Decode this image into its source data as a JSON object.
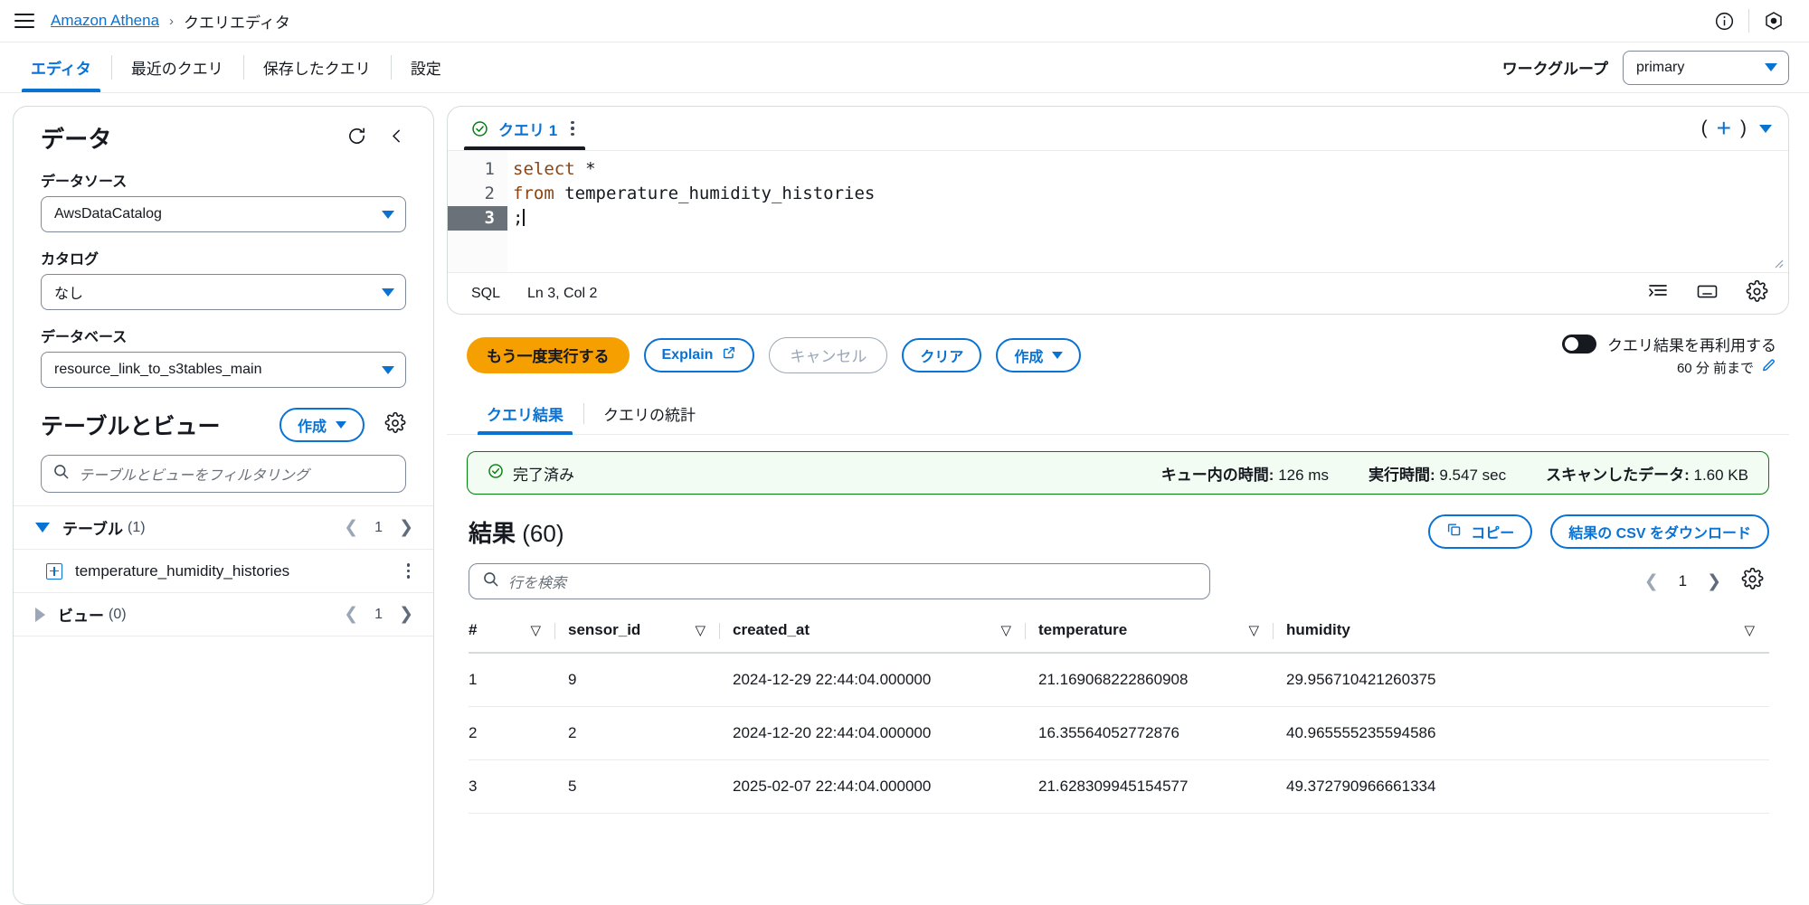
{
  "header": {
    "menu_icon": "hamburger-icon",
    "breadcrumb_root": "Amazon Athena",
    "breadcrumb_sep": "›",
    "breadcrumb_current": "クエリエディタ",
    "info_icon": "info-icon",
    "settings_icon": "aws-console-icon"
  },
  "nav": {
    "tabs": [
      {
        "label": "エディタ",
        "active": true
      },
      {
        "label": "最近のクエリ",
        "active": false
      },
      {
        "label": "保存したクエリ",
        "active": false
      },
      {
        "label": "設定",
        "active": false
      }
    ],
    "workgroup_label": "ワークグループ",
    "workgroup_value": "primary"
  },
  "sidebar": {
    "title": "データ",
    "refresh_icon": "refresh-icon",
    "collapse_icon": "chevron-left-icon",
    "datasource_label": "データソース",
    "datasource_value": "AwsDataCatalog",
    "catalog_label": "カタログ",
    "catalog_value": "なし",
    "database_label": "データベース",
    "database_value": "resource_link_to_s3tables_main",
    "tables_views_title": "テーブルとビュー",
    "create_label": "作成",
    "gear_icon": "gear-icon",
    "filter_placeholder": "テーブルとビューをフィルタリング",
    "tables_group": "テーブル",
    "tables_count": "(1)",
    "tables_page": "1",
    "views_group": "ビュー",
    "views_count": "(0)",
    "views_page": "1",
    "table_items": [
      {
        "name": "temperature_humidity_histories"
      }
    ]
  },
  "editor": {
    "tab_name": "クエリ 1",
    "tab_status_icon": "check-circle-icon",
    "tab_menu_icon": "kebab-menu-icon",
    "add_tab_icon": "plus-icon",
    "tab_list_caret": "chevron-down-icon",
    "paren_left": "(",
    "paren_right": ")",
    "lines": [
      {
        "no": "1",
        "keyword": "select",
        "rest": " *",
        "current": false
      },
      {
        "no": "2",
        "keyword": "from",
        "rest": " temperature_humidity_histories",
        "current": false
      },
      {
        "no": "3",
        "keyword": "",
        "rest": ";",
        "current": true
      }
    ],
    "language": "SQL",
    "cursor_position": "Ln 3, Col 2",
    "format_icon": "format-icon",
    "keyboard_icon": "keyboard-icon",
    "settings_icon": "gear-icon"
  },
  "actions": {
    "run_again": "もう一度実行する",
    "explain": "Explain",
    "explain_icon": "external-link-icon",
    "cancel": "キャンセル",
    "clear": "クリア",
    "create": "作成",
    "reuse_label": "クエリ結果を再利用する",
    "reuse_sub": "60 分 前まで",
    "reuse_edit_icon": "pencil-icon",
    "reuse_enabled": false
  },
  "results": {
    "tabs": [
      {
        "label": "クエリ結果",
        "active": true
      },
      {
        "label": "クエリの統計",
        "active": false
      }
    ],
    "status_icon": "check-circle-icon",
    "status_text": "完了済み",
    "metrics": [
      {
        "label": "キュー内の時間:",
        "value": "126 ms"
      },
      {
        "label": "実行時間:",
        "value": "9.547 sec"
      },
      {
        "label": "スキャンしたデータ:",
        "value": "1.60 KB"
      }
    ],
    "title": "結果",
    "count": "(60)",
    "copy_label": "コピー",
    "copy_icon": "copy-icon",
    "download_label": "結果の CSV をダウンロード",
    "search_placeholder": "行を検索",
    "search_icon": "search-icon",
    "page": "1",
    "prev_icon": "chevron-left-icon",
    "next_icon": "chevron-right-icon",
    "gear_icon": "gear-icon",
    "columns": [
      "#",
      "sensor_id",
      "created_at",
      "temperature",
      "humidity"
    ],
    "rows": [
      [
        "1",
        "9",
        "2024-12-29 22:44:04.000000",
        "21.169068222860908",
        "29.956710421260375"
      ],
      [
        "2",
        "2",
        "2024-12-20 22:44:04.000000",
        "16.35564052772876",
        "40.965555235594586"
      ],
      [
        "3",
        "5",
        "2025-02-07 22:44:04.000000",
        "21.628309945154577",
        "49.372790966661334"
      ]
    ]
  },
  "colors": {
    "accent_blue": "#0972d3",
    "orange": "#f59f00",
    "success_green": "#037f0c",
    "success_bg": "#f2fcf3"
  }
}
